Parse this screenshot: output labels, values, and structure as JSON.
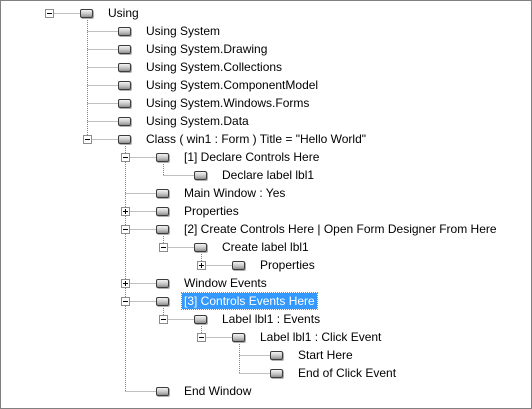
{
  "tree": {
    "nodes": [
      {
        "label": "Using",
        "expandable": true,
        "expanded": true,
        "selected": false
      },
      {
        "label": "Using System",
        "expandable": false,
        "expanded": false,
        "selected": false
      },
      {
        "label": "Using System.Drawing",
        "expandable": false,
        "expanded": false,
        "selected": false
      },
      {
        "label": "Using System.Collections",
        "expandable": false,
        "expanded": false,
        "selected": false
      },
      {
        "label": "Using System.ComponentModel",
        "expandable": false,
        "expanded": false,
        "selected": false
      },
      {
        "label": "Using System.Windows.Forms",
        "expandable": false,
        "expanded": false,
        "selected": false
      },
      {
        "label": "Using System.Data",
        "expandable": false,
        "expanded": false,
        "selected": false
      },
      {
        "label": "Class ( win1 : Form )  Title = \"Hello World\"",
        "expandable": true,
        "expanded": true,
        "selected": false
      },
      {
        "label": "[1] Declare Controls Here",
        "expandable": true,
        "expanded": true,
        "selected": false
      },
      {
        "label": "Declare label lbl1",
        "expandable": false,
        "expanded": false,
        "selected": false
      },
      {
        "label": "Main Window : Yes",
        "expandable": false,
        "expanded": false,
        "selected": false
      },
      {
        "label": "Properties",
        "expandable": true,
        "expanded": false,
        "selected": false
      },
      {
        "label": "[2] Create Controls Here |  Open Form Designer From Here",
        "expandable": true,
        "expanded": true,
        "selected": false
      },
      {
        "label": "Create label lbl1",
        "expandable": true,
        "expanded": true,
        "selected": false
      },
      {
        "label": "Properties",
        "expandable": true,
        "expanded": false,
        "selected": false
      },
      {
        "label": "Window Events",
        "expandable": true,
        "expanded": false,
        "selected": false
      },
      {
        "label": "[3] Controls Events Here",
        "expandable": true,
        "expanded": true,
        "selected": true
      },
      {
        "label": "Label lbl1 : Events",
        "expandable": true,
        "expanded": true,
        "selected": false
      },
      {
        "label": "Label lbl1 : Click Event",
        "expandable": true,
        "expanded": true,
        "selected": false
      },
      {
        "label": "Start Here",
        "expandable": false,
        "expanded": false,
        "selected": false
      },
      {
        "label": "End of Click Event",
        "expandable": false,
        "expanded": false,
        "selected": false
      },
      {
        "label": "End Window",
        "expandable": false,
        "expanded": false,
        "selected": false
      }
    ]
  }
}
